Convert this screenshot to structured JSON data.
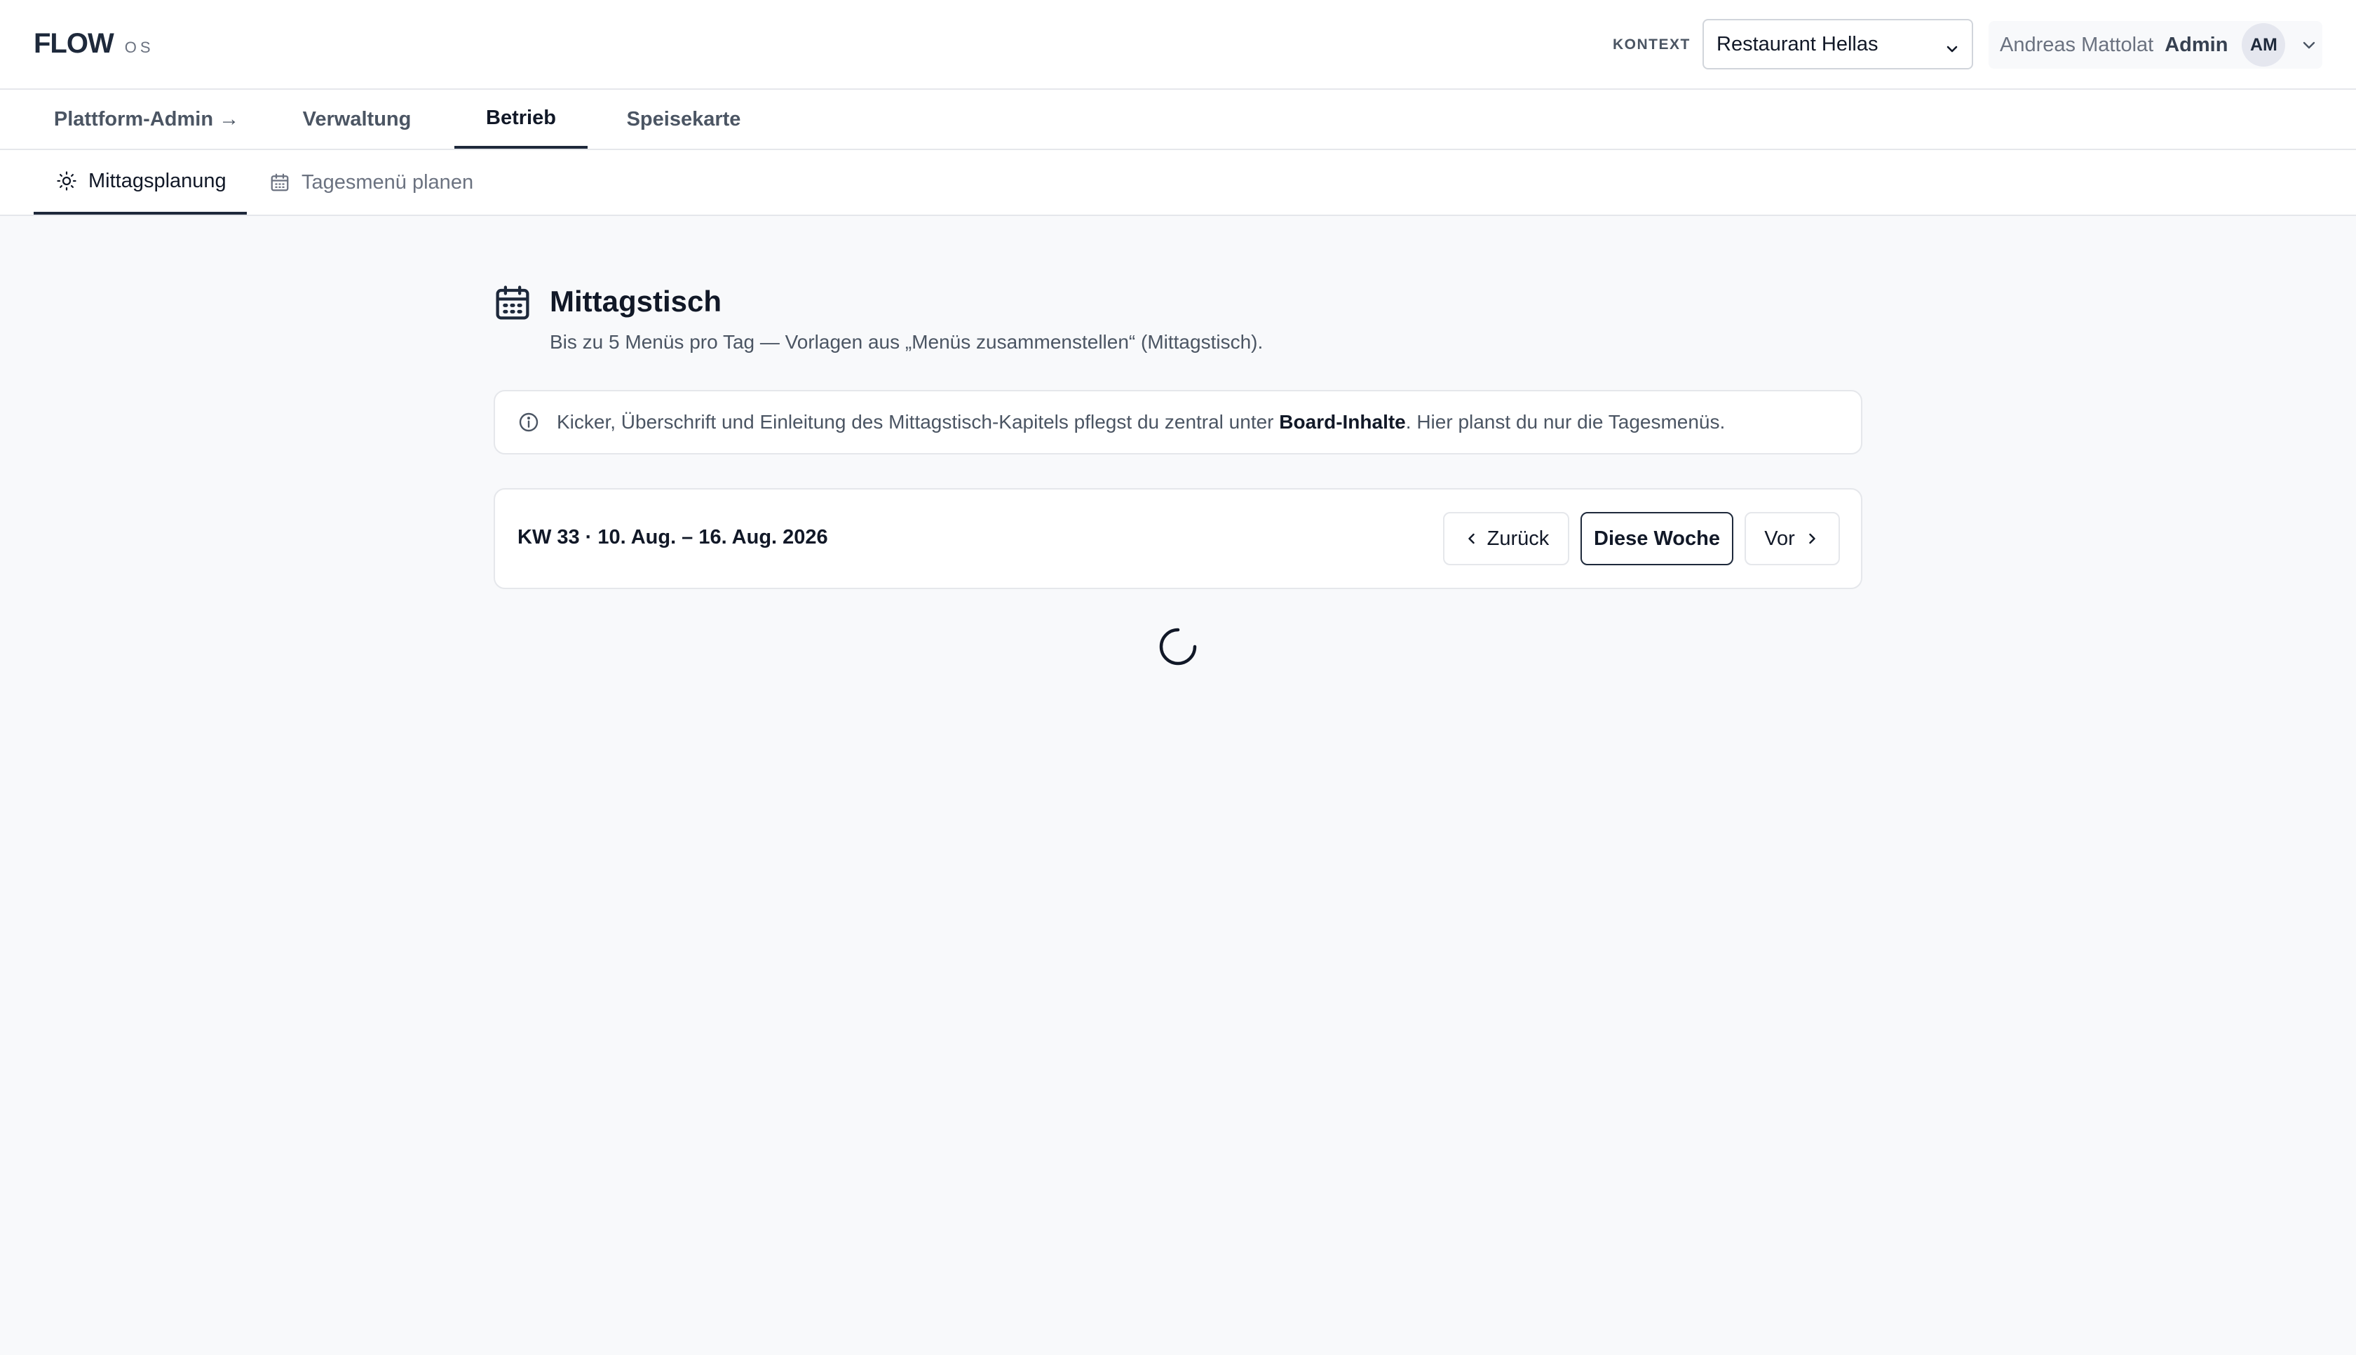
{
  "brand": {
    "name": "FLOW",
    "suffix": "OS"
  },
  "context": {
    "label": "KONTEXT",
    "selected": "Restaurant Hellas"
  },
  "user": {
    "name": "Andreas Mattolat",
    "role": "Admin",
    "initials": "AM"
  },
  "main_tabs": [
    {
      "label": "Plattform-Admin →",
      "active": false
    },
    {
      "label": "Verwaltung",
      "active": false
    },
    {
      "label": "Betrieb",
      "active": true
    },
    {
      "label": "Speisekarte",
      "active": false
    }
  ],
  "sub_tabs": [
    {
      "label": "Mittagsplanung",
      "icon": "sun-icon",
      "active": true
    },
    {
      "label": "Tagesmenü planen",
      "icon": "calendar-icon",
      "active": false
    }
  ],
  "page": {
    "title": "Mittagstisch",
    "subtitle": "Bis zu 5 Menüs pro Tag — Vorlagen aus „Menüs zusammenstellen“ (Mittagstisch).",
    "icon": "calendar-icon"
  },
  "info": {
    "icon": "info-icon",
    "text_before": "Kicker, Überschrift und Einleitung des Mittagstisch-Kapitels pflegst du zentral unter ",
    "link": "Board-Inhalte",
    "text_after": ". Hier planst du nur die Tagesmenüs."
  },
  "week": {
    "label": "KW 33 · 10. Aug. – 16. Aug. 2026",
    "prev_label": "Zurück",
    "current_label": "Diese Woche",
    "next_label": "Vor"
  },
  "colors": {
    "accent": "#1e293b",
    "background": "#f8f9fb",
    "border": "#e5e7eb",
    "muted_text": "#6b7280"
  }
}
